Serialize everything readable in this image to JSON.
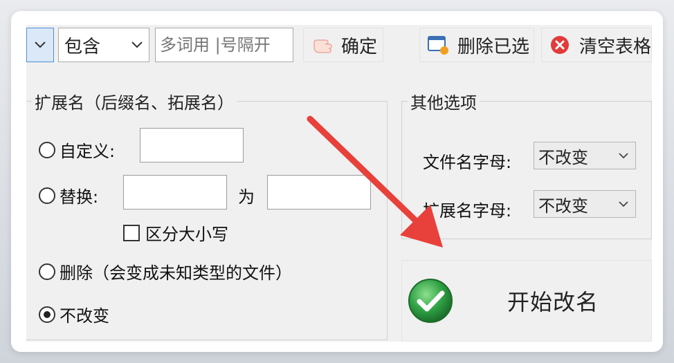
{
  "toolbar": {
    "mode_value": "包含",
    "filter_placeholder": "多词用 |号隔开",
    "confirm_label": "确定",
    "delete_selected_label": "删除已选",
    "clear_table_label": "清空表格"
  },
  "extension": {
    "title": "扩展名（后缀名、拓展名）",
    "custom_label": "自定义:",
    "replace_label": "替换:",
    "replace_with_label": "为",
    "case_sensitive_label": "区分大小写",
    "delete_label": "删除（会变成未知类型的文件）",
    "unchanged_label": "不改变",
    "selected_option": "unchanged"
  },
  "other": {
    "title": "其他选项",
    "filename_case_label": "文件名字母:",
    "filename_case_value": "不改变",
    "ext_case_label": "扩展名字母:",
    "ext_case_value": "不改变"
  },
  "start": {
    "label": "开始改名"
  },
  "colors": {
    "annotation_arrow": "#e8403a",
    "start_icon_green": "#2ea043",
    "clear_icon_red": "#e23b3b"
  }
}
